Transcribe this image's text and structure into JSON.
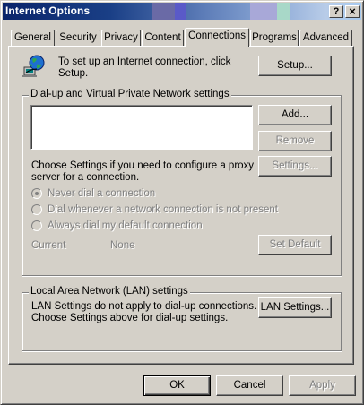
{
  "window": {
    "title": "Internet Options",
    "help_glyph": "?",
    "close_glyph": "×"
  },
  "tabs": [
    {
      "label": "General"
    },
    {
      "label": "Security"
    },
    {
      "label": "Privacy"
    },
    {
      "label": "Content"
    },
    {
      "label": "Connections",
      "active": true
    },
    {
      "label": "Programs"
    },
    {
      "label": "Advanced"
    }
  ],
  "setup": {
    "text_line1": "To set up an Internet connection, click",
    "text_line2": "Setup.",
    "button": "Setup...",
    "icon": "network-globe-icon"
  },
  "dialup": {
    "group_label": "Dial-up and Virtual Private Network settings",
    "add_button": "Add...",
    "remove_button": "Remove",
    "settings_button": "Settings...",
    "hint_line1": "Choose Settings if you need to configure a proxy",
    "hint_line2": "server for a connection.",
    "radios": [
      {
        "label": "Never dial a connection",
        "checked": true
      },
      {
        "label": "Dial whenever a network connection is not present",
        "checked": false
      },
      {
        "label": "Always dial my default connection",
        "checked": false
      }
    ],
    "current_label": "Current",
    "current_value": "None",
    "set_default_button": "Set Default"
  },
  "lan": {
    "group_label": "Local Area Network (LAN) settings",
    "text_line1": "LAN Settings do not apply to dial-up connections.",
    "text_line2": "Choose Settings above for dial-up settings.",
    "button": "LAN Settings..."
  },
  "footer": {
    "ok": "OK",
    "cancel": "Cancel",
    "apply": "Apply"
  }
}
